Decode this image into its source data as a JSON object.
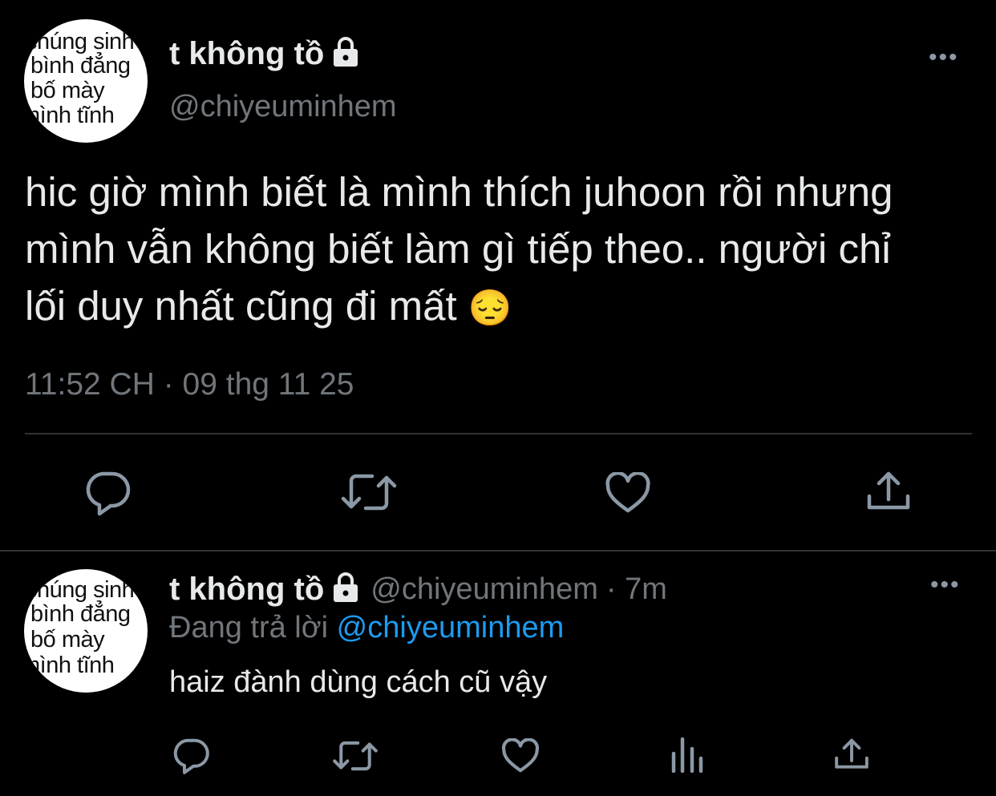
{
  "main_tweet": {
    "avatar_lines": [
      "chúng sinh",
      "bình đẳng",
      "bố     mày",
      "mình   tĩnh"
    ],
    "display_name": "t không tồ",
    "handle": "@chiyeuminhem",
    "text_lines": [
      "hic giờ mình biết là mình thích juhoon rồi nhưng",
      "mình vẫn không biết làm gì tiếp theo.. người chỉ",
      "lối duy nhất cũng đi mất"
    ],
    "emoji": "😔",
    "timestamp": "11:52 CH · 09 thg 11 25",
    "actions": [
      "reply-icon",
      "retweet-icon",
      "like-icon",
      "share-icon"
    ]
  },
  "reply_tweet": {
    "avatar_lines": [
      "chúng sinh",
      "bình đẳng",
      "bố     mày",
      "mình   tĩnh"
    ],
    "display_name": "t không tồ",
    "handle": "@chiyeuminhem",
    "time_ago": "· 7m",
    "replying_prefix": "Đang trả lời",
    "replying_to": "@chiyeuminhem",
    "text": "haiz đành dùng cách cũ vậy",
    "actions": [
      "reply-icon",
      "retweet-icon",
      "like-icon",
      "views-icon",
      "share-icon"
    ]
  },
  "colors": {
    "background": "#000000",
    "text": "#e7e9ea",
    "secondary": "#71767b",
    "link": "#1d9bf0",
    "divider": "#2f3336"
  }
}
